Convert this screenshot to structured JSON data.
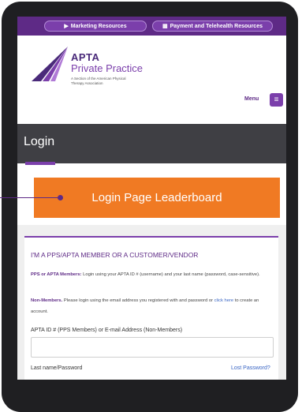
{
  "topbar": {
    "marketing_label": "Marketing Resources",
    "payment_label": "Payment and Telehealth Resources"
  },
  "logo": {
    "name": "APTA",
    "product": "Private Practice",
    "subtitle": "A Section of the American Physical Therapy Association"
  },
  "nav": {
    "menu_label": "Menu",
    "menu_icon": "≡"
  },
  "page": {
    "title": "Login"
  },
  "leaderboard": {
    "label": "Login Page Leaderboard"
  },
  "login_card": {
    "heading": "I'M A PPS/APTA MEMBER OR A CUSTOMER/VENDOR",
    "members_bold": "PPS or APTA Members:",
    "members_text": " Login using your APTA ID # (username) and your last name (password, case-sensitive).",
    "nonmembers_bold": "Non-Members.",
    "nonmembers_text": " Please login using the email address you registered with and password or ",
    "click_here": "click here",
    "nonmembers_tail": " to create an account.",
    "id_label": "APTA ID # (PPS Members) or E-mail Address (Non-Members)",
    "id_value": "",
    "password_label": "Last name/Password",
    "lost_password": "Lost Password?"
  },
  "colors": {
    "brand_purple": "#5e2a86",
    "accent_purple": "#7b3fab",
    "leaderboard_orange": "#f07a23",
    "title_bar": "#3f3f44"
  }
}
